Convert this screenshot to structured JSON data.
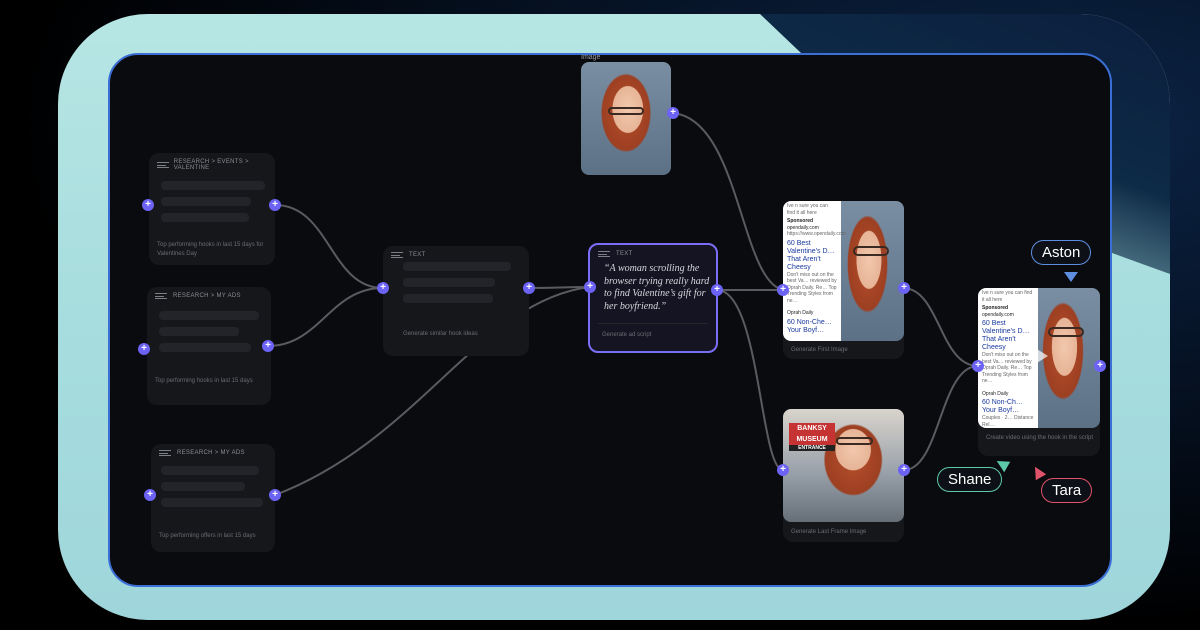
{
  "canvas": {
    "nodes": {
      "research_valentine": {
        "header": "RESEARCH > EVENTS > VALENTINE",
        "caption": "Top performing hooks in last 15 days for Valentines Day"
      },
      "research_ads_1": {
        "header": "RESEARCH > MY ADS",
        "caption": "Top performing hooks in last 15 days"
      },
      "research_ads_2": {
        "header": "RESEARCH > MY ADS",
        "caption": "Top performing offers in last 15 days"
      },
      "text_similar": {
        "header": "TEXT",
        "caption": "Generate similar hook ideas"
      },
      "text_ad_script": {
        "header": "TEXT",
        "quote": "“A woman scrolling the browser trying really hard to find Valentine’s gift for her boyfriend.”",
        "caption": "Generate ad script"
      },
      "image_input": {
        "header": "Image"
      },
      "first_frame": {
        "caption": "Generate First Image",
        "ad_top": "Ive n sure you can find it all here",
        "sponsored": "Sponsored",
        "site": "opendaily.com",
        "site_url": "https://www.opendaily.com",
        "ad_title": "60 Best Valentine's D… That Aren't Cheesy",
        "ad_body": "Don't miss out on the best Va… reviewed by Oprah Daily. Re… Top Trending Styles from ne…",
        "sub_site": "Oprah Daily",
        "sub_title": "60 Non-Che… Your Boyf…"
      },
      "last_frame": {
        "caption": "Generate Last Frame Image",
        "sign": "BANKSY MUSEUM",
        "sign_sub": "ENTRANCE"
      },
      "video_output": {
        "caption": "Create video using the hook in the script",
        "ad_top": "Ive n sure you can find it all here",
        "sponsored": "Sponsored",
        "site": "opendaily.com",
        "ad_title": "60 Best Valentine's D… That Aren't Cheesy",
        "ad_body": "Don't miss out on the best Va… reviewed by Oprah Daily. Re… Top Trending Styles from ne…",
        "sub_site": "Oprah Daily",
        "sub_title": "60 Non-Ch… Your Boyf…",
        "meta": "Couples · 2… Distance Rel…"
      }
    },
    "collaborators": [
      {
        "name": "Aston",
        "color": "#5e8ee0"
      },
      {
        "name": "Shane",
        "color": "#5ec9a8"
      },
      {
        "name": "Tara",
        "color": "#e0526a"
      }
    ],
    "port_glyph": "+",
    "edge_color": "#5a5b60",
    "accent": "#6c63f5"
  }
}
